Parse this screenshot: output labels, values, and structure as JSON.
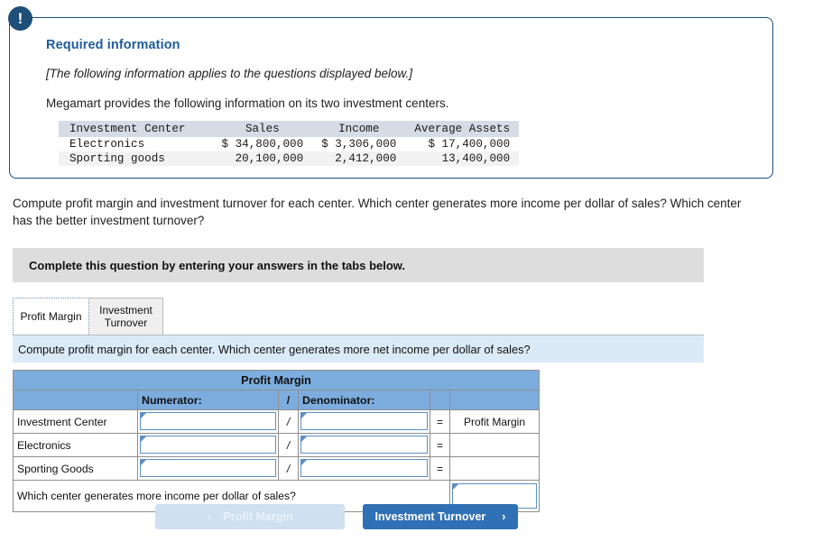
{
  "required_info": {
    "alert_icon": "exclamation-icon",
    "heading": "Required information",
    "applies_note": "[The following information applies to the questions displayed below.]",
    "intro": "Megamart provides the following information on its two investment centers.",
    "table": {
      "headers": [
        "Investment Center",
        "Sales",
        "Income",
        "Average Assets"
      ],
      "rows": [
        {
          "center": "Electronics",
          "sales": "$ 34,800,000",
          "income": "$ 3,306,000",
          "average_assets": "$ 17,400,000"
        },
        {
          "center": "Sporting goods",
          "sales": "20,100,000",
          "income": "2,412,000",
          "average_assets": "13,400,000"
        }
      ]
    }
  },
  "question_prompt": "Compute profit margin and investment turnover for each center. Which center generates more income per dollar of sales? Which center has the better investment turnover?",
  "complete_banner": {
    "text": "Complete this question by entering your answers in the tabs below."
  },
  "tabs": [
    {
      "label": "Profit Margin",
      "active": true
    },
    {
      "label": "Investment Turnover",
      "active": false
    }
  ],
  "instruction_bar": {
    "text": "Compute profit margin for each center. Which center generates more net income per dollar of sales?"
  },
  "answer_table": {
    "title": "Profit Margin",
    "column_headers": {
      "blank_left": "",
      "numerator": "Numerator:",
      "operator": "/",
      "denominator": "Denominator:",
      "equals_blank": "",
      "result_blank": ""
    },
    "rows": [
      {
        "label": "Investment Center",
        "numerator": "",
        "operator": "/",
        "denominator": "",
        "equals": "=",
        "result": "Profit Margin"
      },
      {
        "label": "Electronics",
        "numerator": "",
        "operator": "/",
        "denominator": "",
        "equals": "=",
        "result": ""
      },
      {
        "label": "Sporting Goods",
        "numerator": "",
        "operator": "/",
        "denominator": "",
        "equals": "=",
        "result": ""
      }
    ],
    "footer": {
      "question": "Which center generates more income per dollar of sales?",
      "answer": ""
    }
  },
  "nav": {
    "prev_label": "Profit Margin",
    "prev_chevron": "‹",
    "next_label": "Investment Turnover",
    "next_chevron": "›"
  },
  "colors": {
    "card_border": "#1f4e79",
    "heading_blue": "#1f5c99",
    "table_header_blue": "#7cadde",
    "instruction_bg": "#dbeaf7",
    "banner_gray": "#dddddd",
    "next_button_blue": "#3070b5",
    "prev_button_blue": "#cfe0f0",
    "input_border_blue": "#5c8fc4"
  }
}
